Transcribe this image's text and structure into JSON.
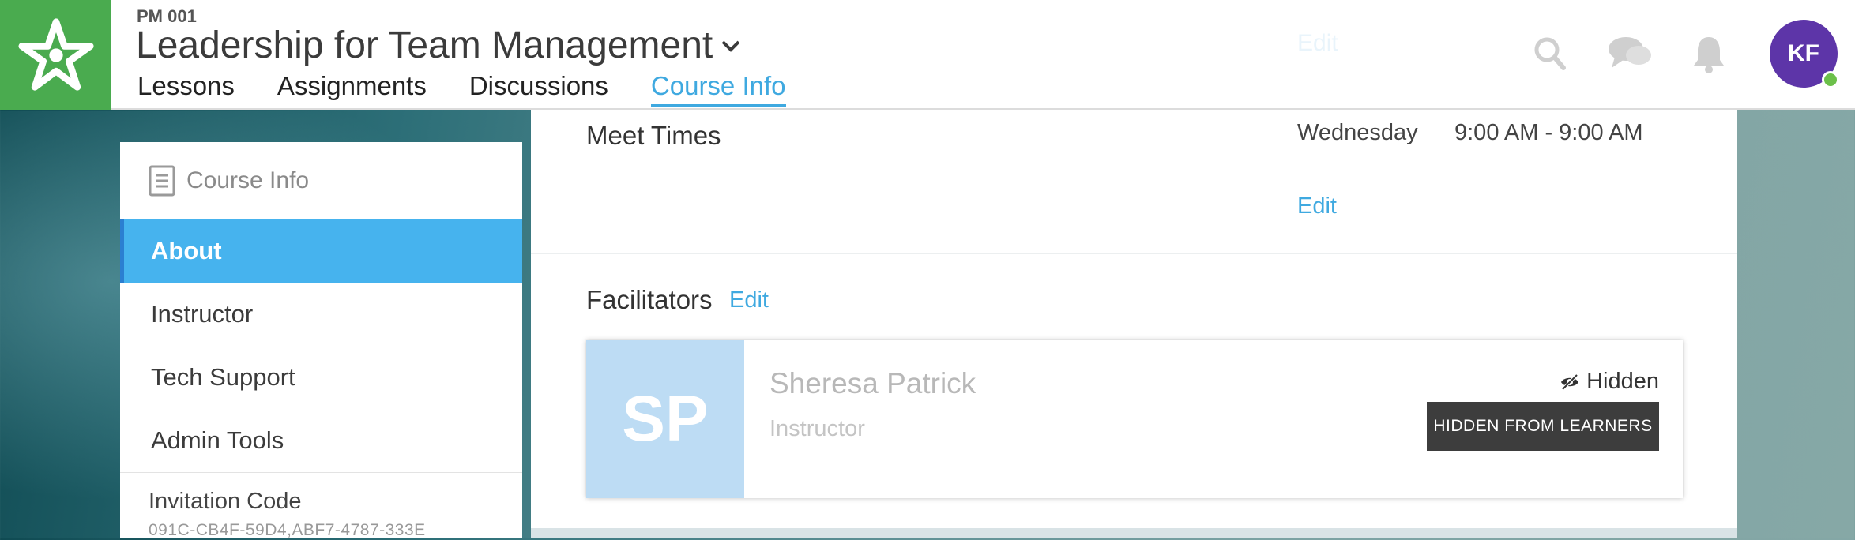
{
  "header": {
    "course_code": "PM 001",
    "course_title": "Leadership for Team Management",
    "faded_edit": "Edit",
    "tabs": [
      {
        "label": "Lessons"
      },
      {
        "label": "Assignments"
      },
      {
        "label": "Discussions"
      },
      {
        "label": "Course Info",
        "active": true
      }
    ],
    "icons": [
      "search-icon",
      "chat-icon",
      "bell-icon"
    ],
    "avatar_initials": "KF",
    "colors": {
      "brand_green": "#4aab4f",
      "accent_blue": "#3fa9e0",
      "avatar_purple": "#5d35a8",
      "online_green": "#6cc04a"
    }
  },
  "sidebar": {
    "title": "Course Info",
    "items": [
      {
        "label": "About",
        "active": true
      },
      {
        "label": "Instructor"
      },
      {
        "label": "Tech Support"
      },
      {
        "label": "Admin Tools"
      }
    ],
    "invitation_label": "Invitation Code",
    "invitation_code": "091C-CB4F-59D4,ABF7-4787-333E"
  },
  "main": {
    "meet_times": {
      "label": "Meet Times",
      "day": "Wednesday",
      "time": "9:00 AM - 9:00 AM",
      "edit_label": "Edit"
    },
    "facilitators": {
      "label": "Facilitators",
      "edit_label": "Edit",
      "cards": [
        {
          "initials": "SP",
          "name": "Sheresa Patrick",
          "role": "Instructor",
          "visibility_label": "Hidden",
          "status_button": "HIDDEN FROM LEARNERS"
        }
      ]
    }
  }
}
